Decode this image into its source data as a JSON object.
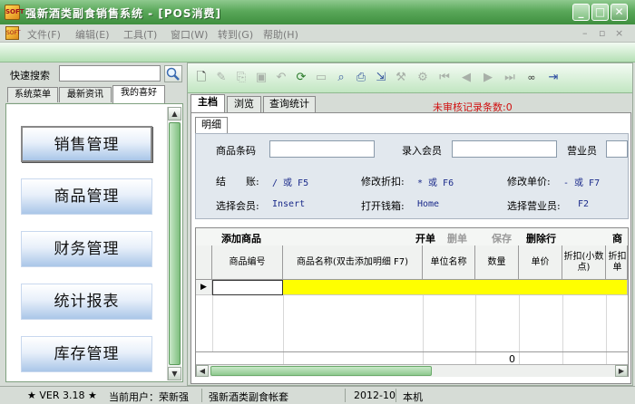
{
  "window": {
    "title": "强新酒类副食销售系统 - [POS消费]",
    "icon_text": "SOFT"
  },
  "menu": {
    "items": [
      "文件(F)",
      "编辑(E)",
      "工具(T)",
      "窗口(W)",
      "转到(G)",
      "帮助(H)"
    ]
  },
  "sidebar": {
    "search_label": "快速搜索",
    "search_value": "",
    "tabs": [
      "系统菜单",
      "最新资讯",
      "我的喜好"
    ],
    "active_tab": "我的喜好",
    "nav_items": [
      "销售管理",
      "商品管理",
      "财务管理",
      "统计报表",
      "库存管理"
    ]
  },
  "toolbar": {
    "icons": [
      "new-icon",
      "edit-icon",
      "copy-icon",
      "save-icon",
      "undo-icon",
      "refresh-icon",
      "print-preview-icon",
      "find-icon",
      "print-icon",
      "export-icon",
      "tools-icon",
      "settings-icon",
      "first-icon",
      "prev-icon",
      "next-icon",
      "last-icon",
      "glasses-icon",
      "exit-icon"
    ]
  },
  "main_tabs": [
    "主档",
    "浏览",
    "查询统计"
  ],
  "active_main_tab": "主档",
  "unreviewed_label": "未审核记录条数:0",
  "sub_tab": "明细",
  "form": {
    "barcode_label": "商品条码",
    "barcode_value": "",
    "member_label": "录入会员",
    "member_value": "",
    "salesman_label": "营业员",
    "salesman_value": ""
  },
  "hotkeys": [
    {
      "label": "结　　账:",
      "keys": "/ 或 F5"
    },
    {
      "label": "修改折扣:",
      "keys": "* 或 F6"
    },
    {
      "label": "修改单价:",
      "keys": "- 或 F7"
    },
    {
      "label": "选择会员:",
      "keys": "Insert"
    },
    {
      "label": "打开钱箱:",
      "keys": "Home"
    },
    {
      "label": "选择营业员:",
      "keys": "F2"
    }
  ],
  "grid": {
    "add_label": "添加商品",
    "actions": [
      {
        "label": "开单",
        "enabled": true
      },
      {
        "label": "删单",
        "enabled": false
      },
      {
        "label": "保存",
        "enabled": false
      },
      {
        "label": "删除行",
        "enabled": true
      },
      {
        "label": "商",
        "enabled": true
      }
    ],
    "columns": [
      "商品编号",
      "商品名称(双击添加明细 F7)",
      "单位名称",
      "数量",
      "单价",
      "折扣(小数点)",
      "折扣单"
    ],
    "row_marker": "▶",
    "footer_quantity": "0"
  },
  "status": {
    "version": "★ VER 3.18 ★",
    "current_user": "当前用户：荣新强",
    "company": "强新酒类副食帐套",
    "period": "2012-10",
    "machine": "本机"
  },
  "colors": {
    "title_green": "#5aa85a",
    "highlight_yellow": "#ffff00",
    "alert_red": "#d01010",
    "hotkey_blue": "#1a2a8a"
  }
}
